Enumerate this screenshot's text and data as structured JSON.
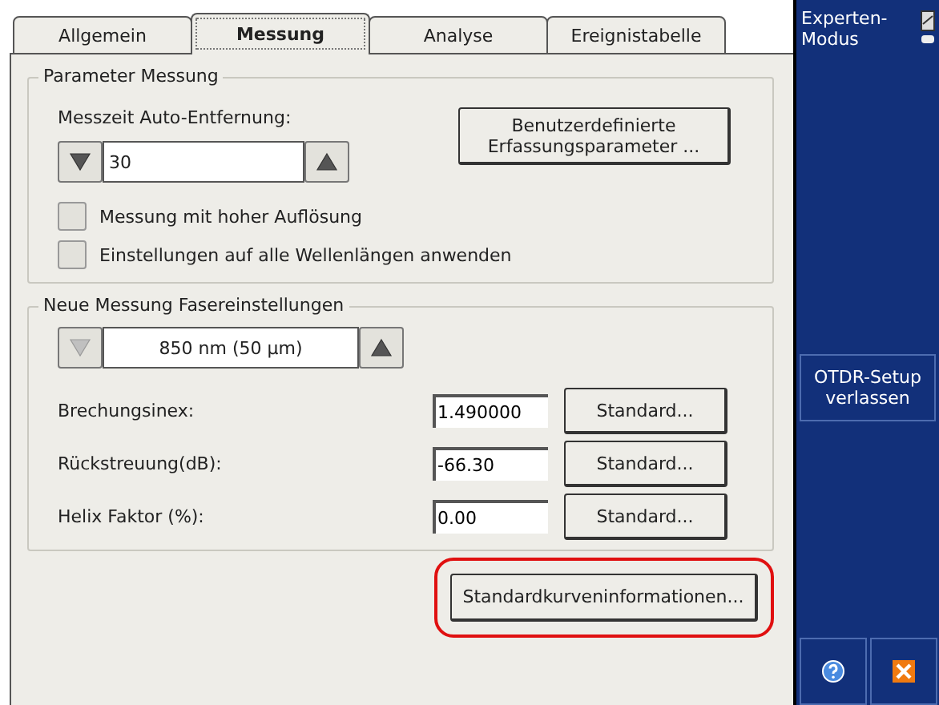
{
  "tabs": [
    {
      "label": "Allgemein",
      "selected": false
    },
    {
      "label": "Messung",
      "selected": true
    },
    {
      "label": "Analyse",
      "selected": false
    },
    {
      "label": "Ereignistabelle",
      "selected": false
    }
  ],
  "parameter_group": {
    "title": "Parameter Messung",
    "spinner_label": "Messzeit Auto-Entfernung:",
    "spinner": {
      "value": "30",
      "down_disabled": false,
      "up_disabled": false
    },
    "custom_button": "Benutzerdefinierte Erfassungsparameter ...",
    "checkboxes": [
      {
        "label": "Messung mit hoher Auflösung",
        "checked": false
      },
      {
        "label": "Einstellungen auf alle Wellenlängen anwenden",
        "checked": false
      }
    ]
  },
  "fiber_group": {
    "title": "Neue Messung Fasereinstellungen",
    "spinner": {
      "value": "850 nm (50 µm)",
      "down_disabled": true,
      "up_disabled": false
    },
    "rows": [
      {
        "label": "Brechungsinex:",
        "value": "1.490000",
        "button": "Standard..."
      },
      {
        "label": "Rückstreuung(dB):",
        "value": "-66.30",
        "button": "Standard..."
      },
      {
        "label": "Helix Faktor (%):",
        "value": "0.00",
        "button": "Standard..."
      }
    ]
  },
  "bottom_button": {
    "label": "Standardkurveninformationen...",
    "highlighted": true
  },
  "sidebar": {
    "mode": "Experten-Modus",
    "exit_button": "OTDR-Setup verlassen"
  }
}
